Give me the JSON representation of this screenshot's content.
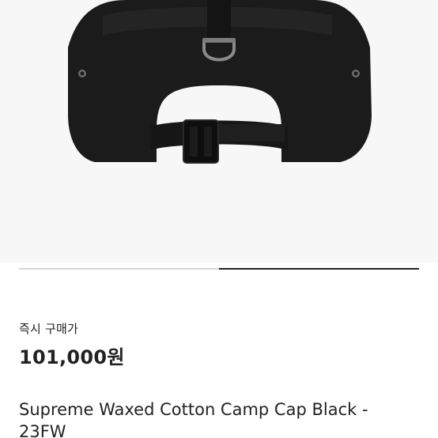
{
  "product": {
    "image_alt": "Supreme Waxed Cotton Camp Cap Black - 23FW",
    "price_label": "즉시 구매가",
    "price": "101,000원",
    "title": "Supreme Waxed Cotton Camp Cap Black - 23FW"
  },
  "carousel": {
    "total_slides": 2,
    "active_slide": 2
  },
  "colors": {
    "background": "#ffffff",
    "image_background": "#f7f7f7",
    "text": "#222222",
    "indicator_track": "#d8d8d8",
    "indicator_active": "#222222"
  }
}
